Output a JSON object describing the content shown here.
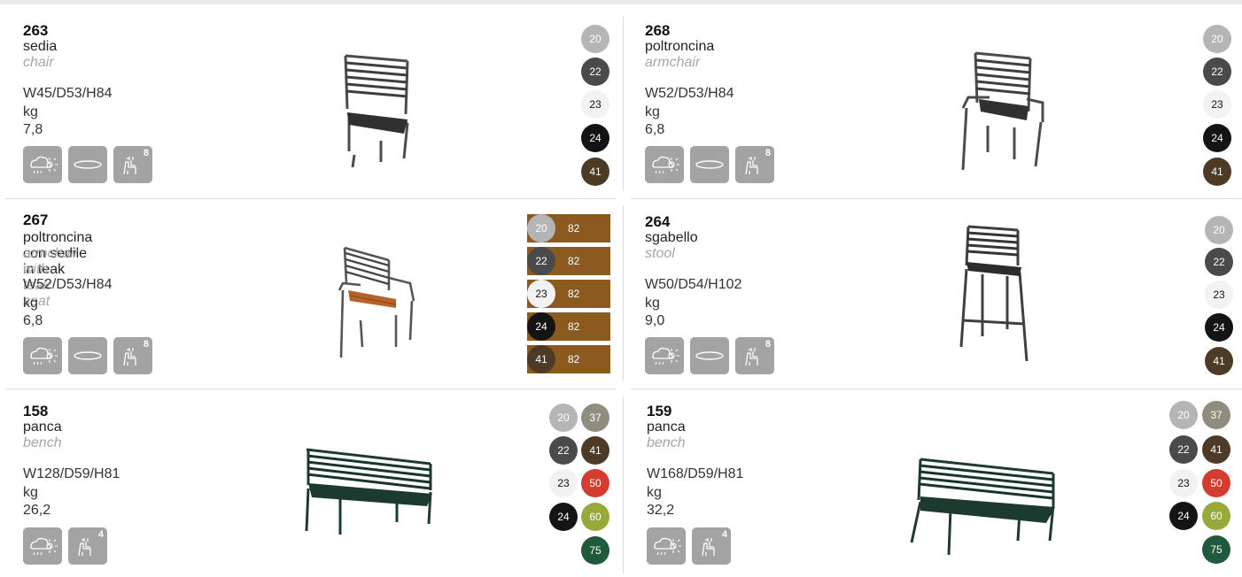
{
  "colors": {
    "20": "#b5b5b5",
    "22": "#4a4a4a",
    "23": "#f2f2f2",
    "24": "#141414",
    "41": "#4d3b27",
    "37": "#8f8d7e",
    "50": "#d43c2f",
    "60": "#99a83a",
    "75": "#1f5a3d",
    "teak": "#8a5a1f"
  },
  "products": [
    {
      "code": "263",
      "name": "sedia",
      "sub": "chair",
      "dims": "W45/D53/H84",
      "weight": "kg 7,8",
      "icons": [
        "weather-icon",
        "ellipse-cushion-icon",
        "stack-icon"
      ],
      "stack": "8",
      "finishes": [
        "20",
        "22",
        "23",
        "24",
        "41"
      ]
    },
    {
      "code": "268",
      "name": "poltroncina",
      "sub": "armchair",
      "dims": "W52/D53/H84",
      "weight": "kg 6,8",
      "icons": [
        "weather-icon",
        "ellipse-cushion-icon",
        "stack-icon"
      ],
      "stack": "8",
      "finishes": [
        "20",
        "22",
        "23",
        "24",
        "41"
      ]
    },
    {
      "code": "267",
      "name": "poltroncina con sedile in teak",
      "sub": "armchair with teak seat",
      "dims": "W52/D53/H84",
      "weight": "kg 6,8",
      "icons": [
        "weather-icon",
        "ellipse-cushion-icon",
        "stack-icon"
      ],
      "stack": "8",
      "finishes": [
        "20",
        "22",
        "23",
        "24",
        "41"
      ],
      "teak": "82"
    },
    {
      "code": "264",
      "name": "sgabello",
      "sub": "stool",
      "dims": "W50/D54/H102",
      "weight": "kg 9,0",
      "icons": [
        "weather-icon",
        "ellipse-cushion-icon",
        "stack-icon"
      ],
      "stack": "8",
      "finishes": [
        "20",
        "22",
        "23",
        "24",
        "41"
      ]
    },
    {
      "code": "158",
      "name": "panca",
      "sub": "bench",
      "dims": "W128/D59/H81",
      "weight": "kg 26,2",
      "icons": [
        "weather-icon",
        "stack-icon"
      ],
      "stack": "4",
      "finishes": [
        "20",
        "37",
        "22",
        "41",
        "23",
        "50",
        "24",
        "60",
        "75"
      ]
    },
    {
      "code": "159",
      "name": "panca",
      "sub": "bench",
      "dims": "W168/D59/H81",
      "weight": "kg 32,2",
      "icons": [
        "weather-icon",
        "stack-icon"
      ],
      "stack": "4",
      "finishes": [
        "20",
        "37",
        "22",
        "41",
        "23",
        "50",
        "24",
        "60",
        "75"
      ]
    }
  ]
}
